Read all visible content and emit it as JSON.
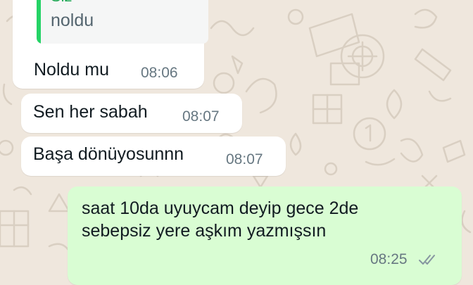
{
  "chat": {
    "colors": {
      "wallpaper": "#efe7dd",
      "incoming_bubble": "#ffffff",
      "outgoing_bubble": "#d9fdd3",
      "reply_accent": "#25d366",
      "tick_color": "#8696a0"
    },
    "reply": {
      "author": "Siz",
      "text": "noldu"
    },
    "messages": [
      {
        "text": "Noldu mu",
        "time": "08:06",
        "direction": "incoming"
      },
      {
        "text": "Sen her sabah",
        "time": "08:07",
        "direction": "incoming"
      },
      {
        "text": "Başa dönüyosunnn",
        "time": "08:07",
        "direction": "incoming"
      },
      {
        "lines": [
          "saat 10da uyuycam deyip gece 2de",
          "sebepsiz yere aşkım yazmışsın"
        ],
        "time": "08:25",
        "direction": "outgoing",
        "status_icon": "double-check-icon"
      }
    ]
  }
}
